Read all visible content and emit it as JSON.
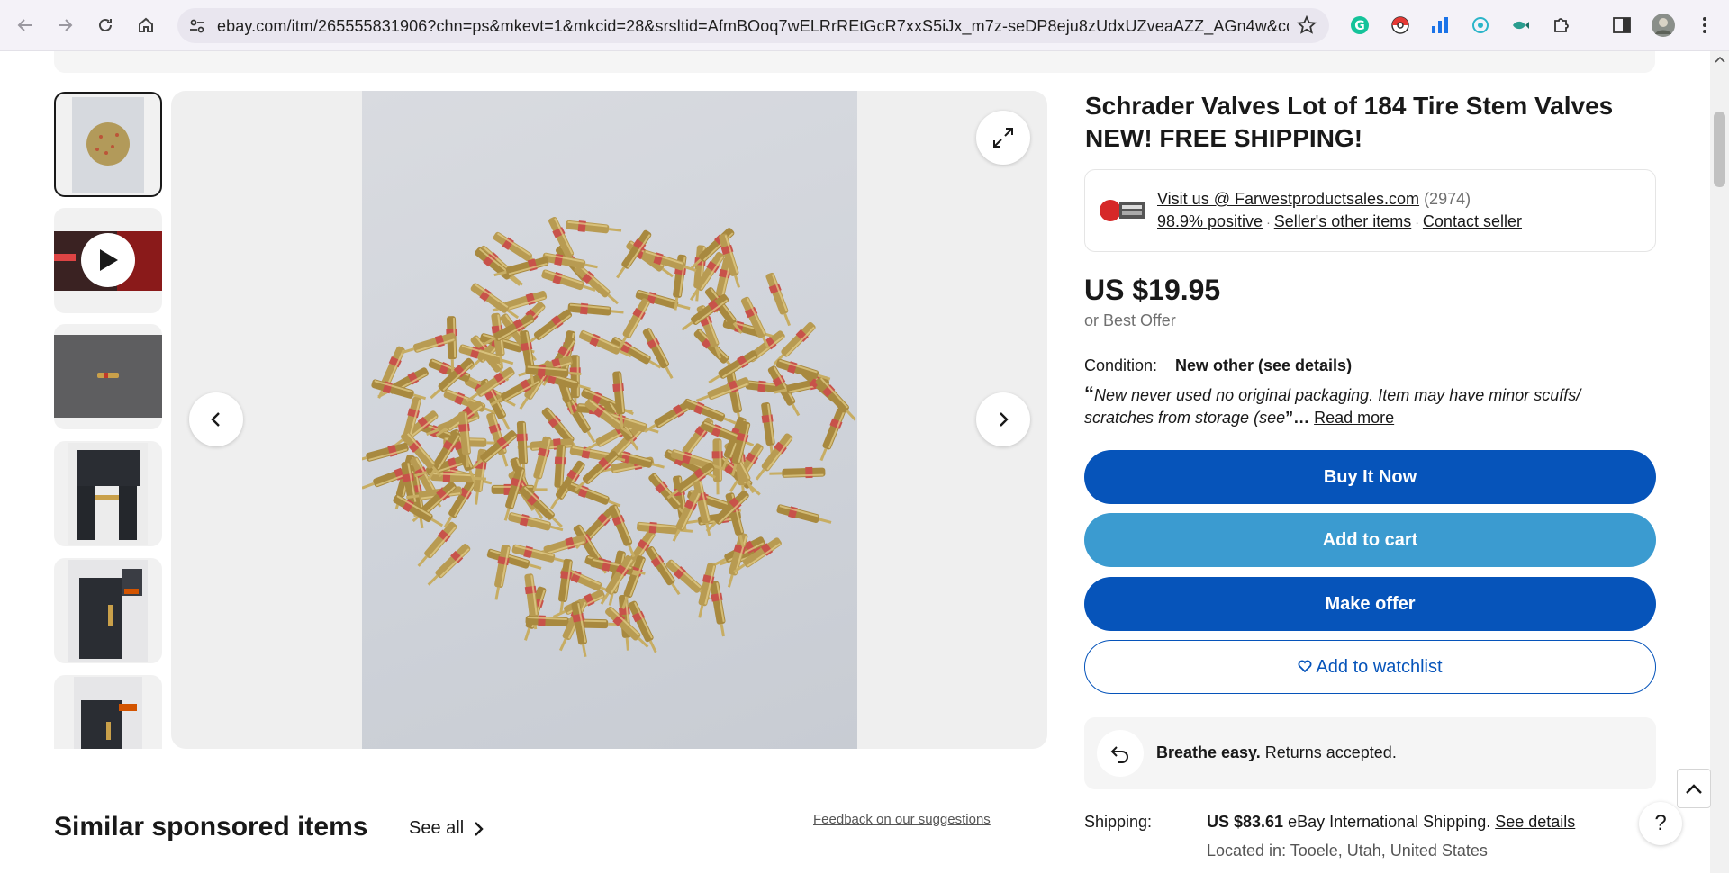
{
  "browser": {
    "url": "ebay.com/itm/265555831906?chn=ps&mkevt=1&mkcid=28&srsltid=AfmBOoq7wELRrREtGcR7xxS5iJx_m7z-seDP8eju8zUdxUZveaAZZ_AGn4w&com_cvv...",
    "icons": [
      "back-icon",
      "forward-icon",
      "reload-icon",
      "home-icon",
      "site-settings-icon",
      "bookmark-star-icon",
      "grammarly-icon",
      "pokeball-extension-icon",
      "analytics-extension-icon",
      "ai-extension-icon",
      "fish-extension-icon",
      "extensions-puzzle-icon",
      "side-panel-icon",
      "profile-avatar",
      "menu-kebab-icon"
    ]
  },
  "gallery": {
    "thumbnails": [
      "Valves pile",
      "Video",
      "Single valve",
      "Caliper measurement",
      "Caliper close-up",
      "Caliper side view"
    ]
  },
  "listing": {
    "title": "Schrader Valves Lot of 184 Tire Stem Valves NEW! FREE SHIPPING!",
    "seller": {
      "name": "Visit us @ Farwestproductsales.com",
      "count": "(2974)",
      "positive": "98.9% positive",
      "other_items": "Seller's other items",
      "contact": "Contact seller",
      "separator": "·"
    },
    "price": "US $19.95",
    "best_offer": "or Best Offer",
    "condition_label": "Condition:",
    "condition_value": "New other (see details)",
    "condition_open_quote": "“",
    "condition_desc": "New never used no original packaging. Item may have minor scuffs/ scratches from storage (see",
    "condition_close": "”…",
    "read_more": "Read more",
    "buttons": {
      "buy": "Buy It Now",
      "cart": "Add to cart",
      "offer": "Make offer",
      "watch": "Add to watchlist"
    },
    "returns": {
      "bold": "Breathe easy.",
      "rest": " Returns accepted."
    },
    "shipping": {
      "label": "Shipping:",
      "price": "US $83.61",
      "method": " eBay International Shipping. ",
      "details": "See details",
      "located": "Located in: Tooele, Utah, United States"
    }
  },
  "similar": {
    "heading": "Similar sponsored items",
    "see_all": "See all",
    "feedback": "Feedback on our suggestions"
  },
  "help": "?",
  "colors": {
    "primary_blue": "#0654ba",
    "cart_blue": "#3b9bd0",
    "text": "#191919"
  }
}
